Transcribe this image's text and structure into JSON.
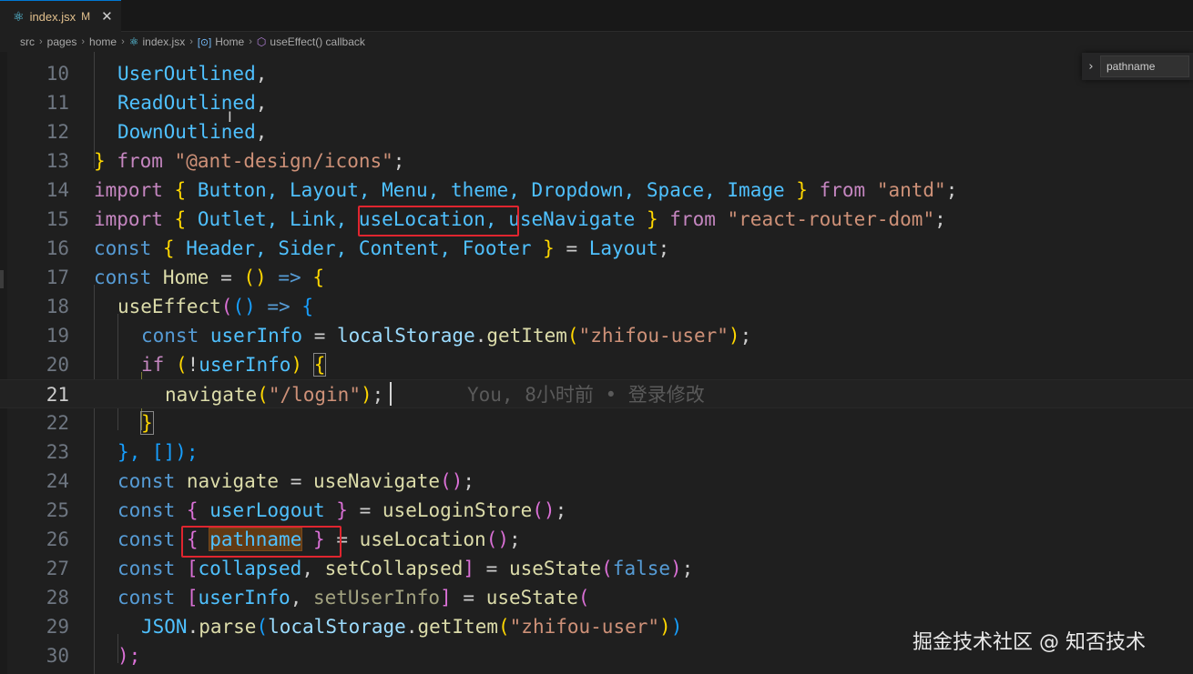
{
  "tab": {
    "filename": "index.jsx",
    "status": "M",
    "close_glyph": "✕",
    "icon": "react-icon"
  },
  "breadcrumb": {
    "items": [
      "src",
      "pages",
      "home",
      "index.jsx",
      "Home",
      "useEffect() callback"
    ],
    "separator": "›"
  },
  "find": {
    "value": "pathname",
    "toggle_glyph": "›"
  },
  "editor": {
    "current_line": "21",
    "blame": "You, 8小时前 • 登录修改",
    "line_numbers": [
      "10",
      "11",
      "12",
      "13",
      "14",
      "15",
      "16",
      "17",
      "18",
      "19",
      "20",
      "21",
      "22",
      "23",
      "24",
      "25",
      "26",
      "27",
      "28",
      "29",
      "30"
    ],
    "tokens": {
      "l10_a": "UserOutlined",
      "l11_a": "ReadOutlined",
      "l12_a": "DownOutlined",
      "comma": ",",
      "l13_brace": "}",
      "from": "from",
      "l13_str": "\"@ant-design/icons\"",
      "semi": ";",
      "import": "import",
      "l14_open": "{",
      "l14_names": "Button, Layout, Menu, theme, Dropdown, Space, Image",
      "l14_close": "}",
      "l14_str": "\"antd\"",
      "l15_names_a": "Outlet, Link,",
      "l15_uselocation": "useLocation,",
      "l15_usenavigate": "useNavigate",
      "l15_str": "\"react-router-dom\"",
      "const": "const",
      "l16_names": "Header, Sider, Content, Footer",
      "eq": "=",
      "l16_layout": "Layout",
      "l17_home": "Home",
      "arrow": "=>",
      "paren_pair": "()",
      "l18_useeffect": "useEffect",
      "l19_userinfo": "userInfo",
      "l19_localstorage": "localStorage",
      "dot": ".",
      "getitem": "getItem",
      "l19_str": "\"zhifou-user\"",
      "if": "if",
      "bang": "!",
      "l21_navigate": "navigate",
      "l21_str": "\"/login\"",
      "l23_close": "}, []);",
      "l24_navigate": "navigate",
      "l24_usenavigate": "useNavigate",
      "l25_userlogout": "userLogout",
      "l25_useloginstore": "useLoginStore",
      "l26_pathname": "pathname",
      "l26_uselocation": "useLocation",
      "l27_collapsed": "collapsed",
      "l27_setcollapsed": "setCollapsed",
      "usestate": "useState",
      "false": "false",
      "l28_userinfo": "userInfo",
      "l28_setuserinfo": "setUserInfo",
      "l29_json": "JSON",
      "l29_parse": "parse",
      "l30_close": ");"
    }
  },
  "watermark": "掘金技术社区 @ 知否技术"
}
